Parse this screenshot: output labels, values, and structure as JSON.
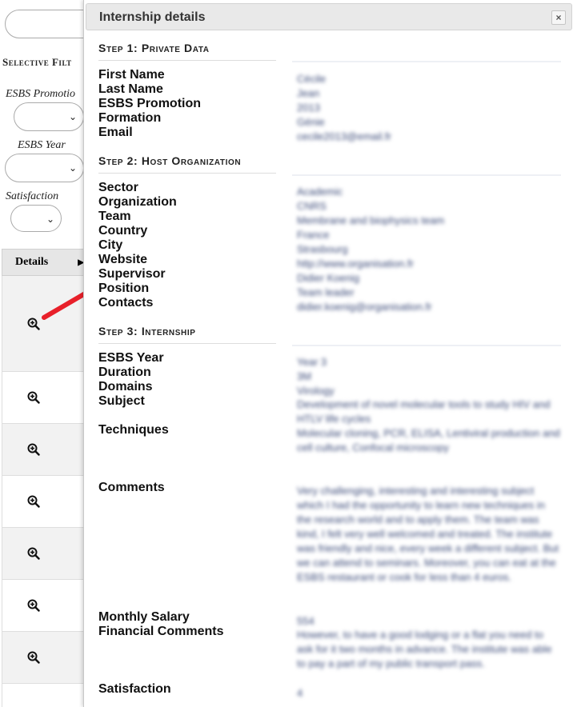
{
  "background": {
    "filters_title": "Selective Filt",
    "filters": [
      {
        "label": "ESBS Promotio"
      },
      {
        "label": "ESBS Year"
      },
      {
        "label": "Satisfaction"
      }
    ],
    "table_header": "Details"
  },
  "dialog": {
    "title": "Internship details",
    "close_glyph": "×",
    "step1": {
      "title": "Step 1: Private Data",
      "labels": {
        "first_name": "First Name",
        "last_name": "Last Name",
        "promotion": "ESBS Promotion",
        "formation": "Formation",
        "email": "Email"
      },
      "values": {
        "first_name": "Cécile",
        "last_name": "Jean",
        "promotion": "2013",
        "formation": "Génie",
        "email": "cecile2013@email.fr"
      }
    },
    "step2": {
      "title": "Step 2: Host Organization",
      "labels": {
        "sector": "Sector",
        "organization": "Organization",
        "team": "Team",
        "country": "Country",
        "city": "City",
        "website": "Website",
        "supervisor": "Supervisor",
        "position": "Position",
        "contacts": "Contacts"
      },
      "values": {
        "sector": "Academic",
        "organization": "CNRS",
        "team": "Membrane and biophysics team",
        "country": "France",
        "city": "Strasbourg",
        "website": "http://www.organisation.fr",
        "supervisor": "Didier Koenig",
        "position": "Team leader",
        "contacts": "didier.koenig@organisation.fr"
      }
    },
    "step3": {
      "title": "Step 3: Internship",
      "labels": {
        "year": "ESBS Year",
        "duration": "Duration",
        "domains": "Domains",
        "subject": "Subject",
        "techniques": "Techniques",
        "comments": "Comments",
        "salary": "Monthly Salary",
        "financial_comments": "Financial Comments",
        "satisfaction": "Satisfaction"
      },
      "values": {
        "year": "Year 3",
        "duration": "3M",
        "domains": "Virology",
        "subject": "Development of novel molecular tools to study HIV and HTLV life cycles",
        "techniques": "Molecular cloning, PCR, ELISA, Lentiviral production and cell culture, Confocal microscopy",
        "comments": "Very challenging, interesting and interesting subject which I had the opportunity to learn new techniques in the research world and to apply them. The team was kind, I felt very well welcomed and treated. The institute was friendly and nice, every week a different subject. But we can attend to seminars. Moreover, you can eat at the ESBS restaurant or cook for less than 4 euros.",
        "salary": "554",
        "financial_comments": "However, to have a good lodging or a flat you need to ask for it two months in advance. The institute was able to pay a part of my public transport pass.",
        "satisfaction": "4"
      }
    }
  },
  "colors": {
    "titlebar": "#e9e9e9",
    "value_text": "#3b4a78",
    "annotation": "#e8202a"
  }
}
